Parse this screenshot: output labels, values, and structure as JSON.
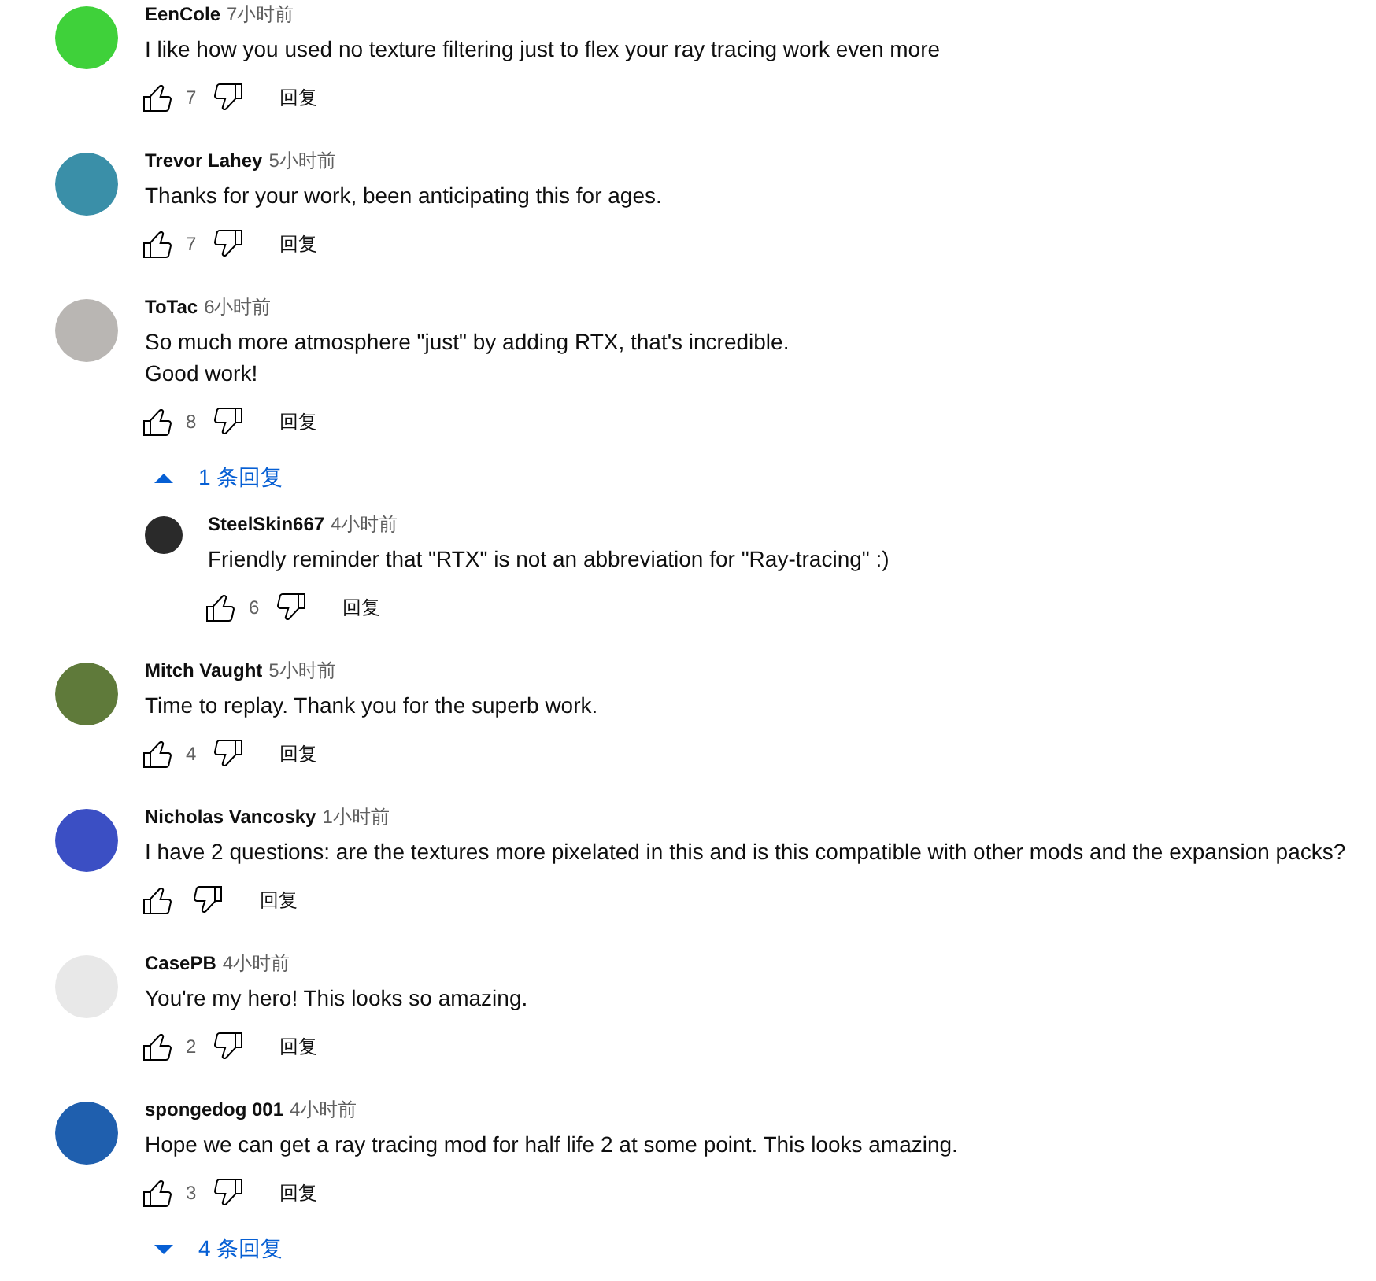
{
  "comments": [
    {
      "author": "EenCole",
      "time": "7小时前",
      "text": "I like how you used no texture filtering just to flex your ray tracing work even more",
      "likes": "7",
      "reply_label": "回复",
      "color": "#3fd13a"
    },
    {
      "author": "Trevor Lahey",
      "time": "5小时前",
      "text": "Thanks for your work, been anticipating this for ages.",
      "likes": "7",
      "reply_label": "回复",
      "color": "#3a8fa8"
    },
    {
      "author": "ToTac",
      "time": "6小时前",
      "text": "So much more atmosphere \"just\" by adding RTX, that's incredible.\nGood work!",
      "likes": "8",
      "reply_label": "回复",
      "color": "#b9b6b3",
      "thread": {
        "label": "1 条回复",
        "expanded": true,
        "replies": [
          {
            "author": "SteelSkin667",
            "time": "4小时前",
            "text": "Friendly reminder that \"RTX\" is not an abbreviation for \"Ray-tracing\" :)",
            "likes": "6",
            "reply_label": "回复",
            "color": "#2a2a2a"
          }
        ]
      }
    },
    {
      "author": "Mitch Vaught",
      "time": "5小时前",
      "text": "Time to replay. Thank you for the superb work.",
      "likes": "4",
      "reply_label": "回复",
      "color": "#5f7a3a"
    },
    {
      "author": "Nicholas Vancosky",
      "time": "1小时前",
      "text": "I have 2 questions: are the textures more pixelated in this and is this compatible with other mods and the expansion packs?",
      "reply_label": "回复",
      "color": "#3b4fc4"
    },
    {
      "author": "CasePB",
      "time": "4小时前",
      "text": "You're my hero!  This looks so amazing.",
      "likes": "2",
      "reply_label": "回复",
      "color": "#e8e8e8"
    },
    {
      "author": "spongedog 001",
      "time": "4小时前",
      "text": "Hope we can get a ray tracing mod for half life 2 at some point. This looks amazing.",
      "likes": "3",
      "reply_label": "回复",
      "color": "#1f5fae",
      "thread": {
        "label": "4 条回复",
        "expanded": false
      }
    }
  ]
}
